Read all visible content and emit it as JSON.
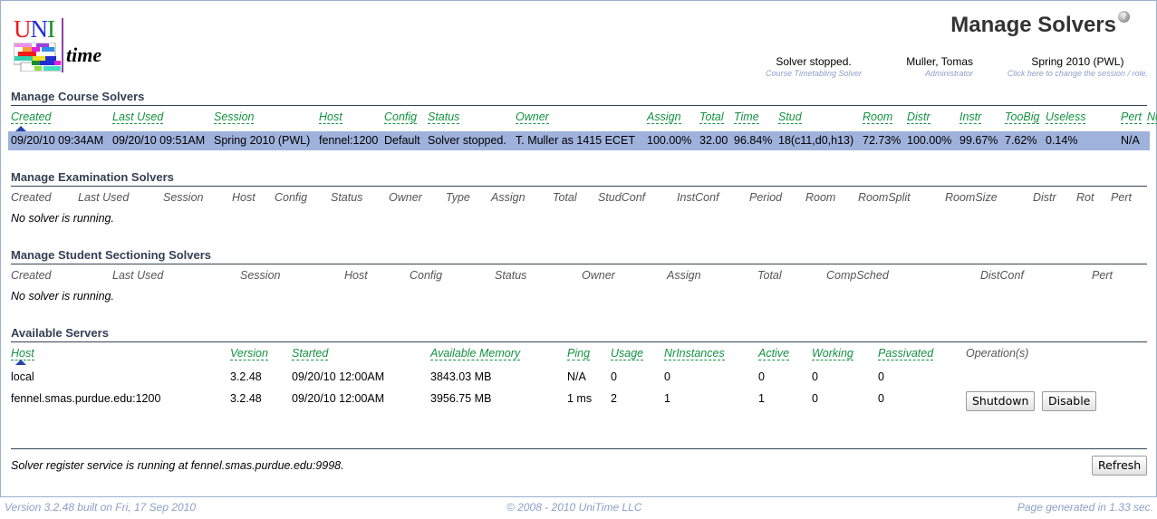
{
  "header": {
    "logo_text": {
      "u": "U",
      "n": "N",
      "i": "I",
      "time": "time"
    },
    "title": "Manage Solvers",
    "help_icon": "?",
    "solver_status": {
      "main": "Solver stopped.",
      "sub": "Course Timetabling Solver"
    },
    "user": {
      "main": "Muller, Tomas",
      "sub": "Administrator"
    },
    "session": {
      "main": "Spring 2010 (PWL)",
      "sub": "Click here to change the session / role."
    }
  },
  "course_solvers": {
    "title": "Manage Course Solvers",
    "columns": [
      "Created",
      "Last Used",
      "Session",
      "Host",
      "Config",
      "Status",
      "Owner",
      "Assign",
      "Total",
      "Time",
      "Stud",
      "Room",
      "Distr",
      "Instr",
      "TooBig",
      "Useless",
      "Pert",
      "Note"
    ],
    "rows": [
      [
        "09/20/10 09:34AM",
        "09/20/10 09:51AM",
        "Spring 2010 (PWL)",
        "fennel:1200",
        "Default",
        "Solver stopped.",
        "T. Muller as 1415 ECET",
        "100.00%",
        "32.00",
        "96.84%",
        "18(c11,d0,h13)",
        "72.73%",
        "100.00%",
        "99.67%",
        "7.62%",
        "0.14%",
        "N/A",
        ""
      ]
    ]
  },
  "exam_solvers": {
    "title": "Manage Examination Solvers",
    "columns": [
      "Created",
      "Last Used",
      "Session",
      "Host",
      "Config",
      "Status",
      "Owner",
      "Type",
      "Assign",
      "Total",
      "StudConf",
      "InstConf",
      "Period",
      "Room",
      "RoomSplit",
      "RoomSize",
      "Distr",
      "Rot",
      "Pert"
    ],
    "empty": "No solver is running."
  },
  "student_solvers": {
    "title": "Manage Student Sectioning Solvers",
    "columns": [
      "Created",
      "Last Used",
      "Session",
      "Host",
      "Config",
      "Status",
      "Owner",
      "Assign",
      "Total",
      "CompSched",
      "DistConf",
      "Pert"
    ],
    "empty": "No solver is running."
  },
  "servers": {
    "title": "Available Servers",
    "columns": [
      "Host",
      "Version",
      "Started",
      "Available Memory",
      "Ping",
      "Usage",
      "NrInstances",
      "Active",
      "Working",
      "Passivated",
      "Operation(s)"
    ],
    "rows": [
      [
        "local",
        "3.2.48",
        "09/20/10 12:00AM",
        "3843.03 MB",
        "N/A",
        "0",
        "0",
        "0",
        "0",
        "0"
      ],
      [
        "fennel.smas.purdue.edu:1200",
        "3.2.48",
        "09/20/10 12:00AM",
        "3956.75 MB",
        "1 ms",
        "2",
        "1",
        "1",
        "0",
        "0"
      ]
    ],
    "shutdown_label": "Shutdown",
    "disable_label": "Disable"
  },
  "bottom": {
    "register_msg": "Solver register service is running at fennel.smas.purdue.edu:9998.",
    "refresh_label": "Refresh"
  },
  "footer": {
    "version": "Version 3.2.48 built on Fri, 17 Sep 2010",
    "copyright": "© 2008 - 2010 UniTime LLC",
    "generated": "Page generated in 1.33 sec."
  },
  "colors": {
    "accent_link": "#139240",
    "selected_row": "#9fb2dc",
    "section_title": "#333f53",
    "footer_text": "#8c9fc9"
  }
}
